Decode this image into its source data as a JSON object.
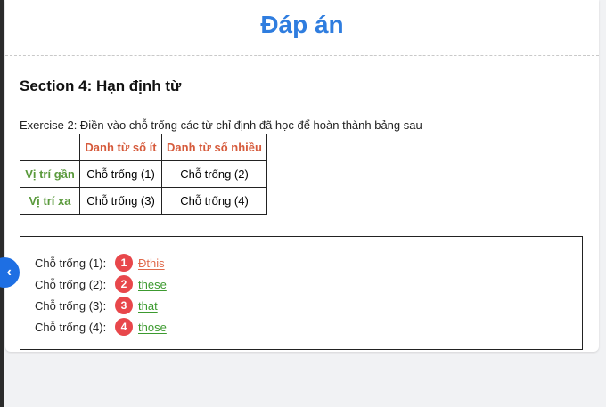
{
  "page": {
    "title": "Đáp án"
  },
  "section": {
    "heading": "Section 4: Hạn định từ",
    "exercise": "Exercise 2: Điền vào chỗ trống các từ chỉ định đã học để hoàn thành bảng sau"
  },
  "table": {
    "headers": [
      "",
      "Danh từ số ít",
      "Danh từ số nhiều"
    ],
    "rows": [
      {
        "label": "Vị trí gần",
        "cells": [
          "Chỗ trống (1)",
          "Chỗ trống (2)"
        ]
      },
      {
        "label": "Vị trí xa",
        "cells": [
          "Chỗ trống (3)",
          "Chỗ trống (4)"
        ]
      }
    ]
  },
  "answers": [
    {
      "label": "Chỗ trống (1):",
      "number": "1",
      "value": "Đthis"
    },
    {
      "label": "Chỗ trống (2):",
      "number": "2",
      "value": "these"
    },
    {
      "label": "Chỗ trống (3):",
      "number": "3",
      "value": "that"
    },
    {
      "label": "Chỗ trống (4):",
      "number": "4",
      "value": "those"
    }
  ],
  "nav": {
    "icon": "chevron-left-icon",
    "glyph": "‹"
  },
  "colors": {
    "title": "#2f7ddf",
    "header_text": "#d65b3c",
    "row_label": "#5a9a3c",
    "badge": "#e8474b",
    "answer_correct": "#3c9a2f",
    "answer_first": "#e0694a",
    "nav_button": "#1e6fe3"
  }
}
